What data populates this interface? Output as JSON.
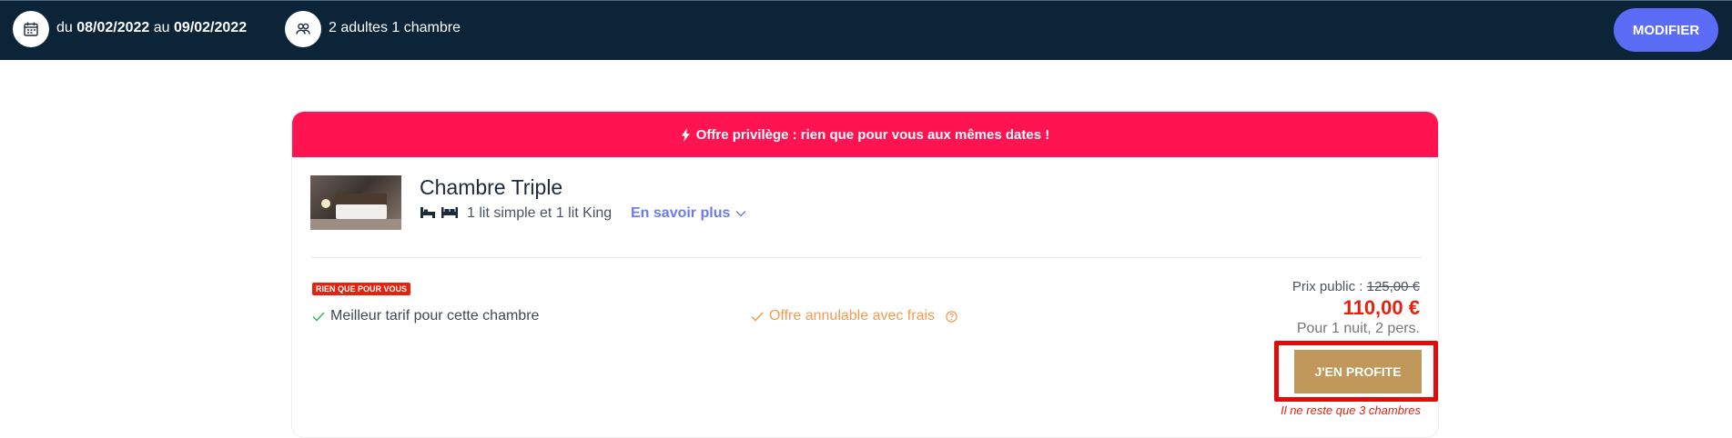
{
  "topbar": {
    "dates_prefix": "du ",
    "date_from": "08/02/2022",
    "dates_mid": " au ",
    "date_to": "09/02/2022",
    "guests": "2 adultes 1 chambre",
    "modify_label": "MODIFIER",
    "calendar_icon": "calendar-icon",
    "people_icon": "people-icon"
  },
  "offer": {
    "banner": "Offre privilège : rien que pour vous aux mêmes dates !",
    "banner_icon": "lightning-icon",
    "room_name": "Chambre Triple",
    "bed_icons": [
      "single-bed-icon",
      "king-bed-icon"
    ],
    "bed_description": "1 lit simple et 1 lit King",
    "more_link": "En savoir plus",
    "badge": "RIEN QUE POUR VOUS",
    "perk_best_rate": "Meilleur tarif pour cette chambre",
    "perk_cancel": "Offre annulable avec frais",
    "public_price_label": "Prix public : ",
    "public_price": "125,00 €",
    "price": "110,00 €",
    "price_details": "Pour 1 nuit, 2 pers.",
    "cta_label": "J'EN PROFITE",
    "remaining": "Il ne reste que 3 chambres"
  },
  "colors": {
    "topbar_bg": "#0c2438",
    "modify_btn": "#5b6cf6",
    "banner_bg": "#ff1351",
    "price_red": "#e3230f",
    "cta_gold": "#c0995a",
    "link_blue": "#6c7bf0",
    "perk_orange": "#f29b52",
    "highlight_frame": "#e00b0b"
  }
}
